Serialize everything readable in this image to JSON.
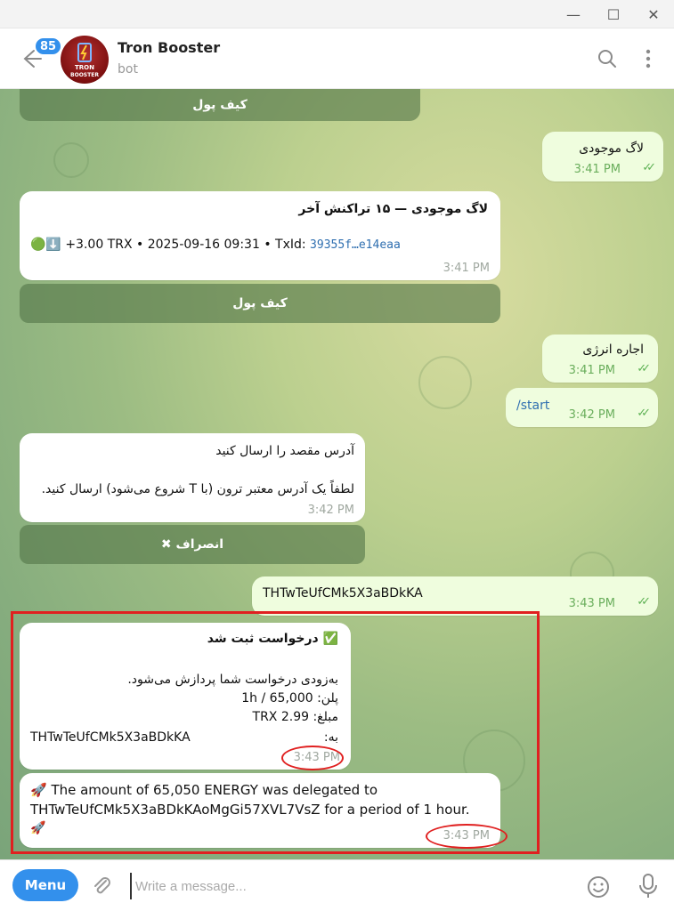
{
  "window": {
    "minimize": "—",
    "maximize": "☐",
    "close": "✕"
  },
  "header": {
    "unread_badge": "85",
    "title": "Tron Booster",
    "subtitle": "bot",
    "avatar_text_line1": "TRON",
    "avatar_text_line2": "BOOSTER"
  },
  "messages": {
    "top_button": "کیف پول",
    "m1_text": "لاگ موجودی",
    "m1_time": "3:41 PM",
    "m2_title": "لاگ موجودی — ۱۵ تراکنش آخر",
    "m2_emoji": "🟢⬇️",
    "m2_amount": " +3.00 TRX • 2025-09-16 09:31 • TxId: ",
    "m2_txid": "39355f…e14eaa",
    "m2_time": "3:41 PM",
    "m2_button": "کیف پول",
    "m3_text": "اجاره انرژی",
    "m3_time": "3:41 PM",
    "m4_text": "/start",
    "m4_time": "3:42 PM",
    "m5_line1": "آدرس مقصد را ارسال کنید",
    "m5_line2": "لطفاً یک آدرس معتبر ترون (با T شروع می‌شود) ارسال کنید.",
    "m5_time": "3:42 PM",
    "m5_button": "✖ انصراف",
    "m6_text": "THTwTeUfCMk5X3aBDkKA",
    "m6_time": "3:43 PM",
    "m7_title": "✅ درخواست ثبت شد",
    "m7_line1": "به‌زودی درخواست شما پردازش می‌شود.",
    "m7_line2": "پلن: 1h / 65,000",
    "m7_line3": "مبلغ: 2.99 TRX",
    "m7_line4_label": "به:",
    "m7_address": "THTwTeUfCMk5X3aBDkKA",
    "m7_time": "3:43 PM",
    "m8_line1": "🚀 The amount of 65,050 ENERGY was delegated to",
    "m8_line2": "THTwTeUfCMk5X3aBDkKAoMgGi57XVL7VsZ for a period of 1 hour.",
    "m8_line3": "🚀",
    "m8_time": "3:43 PM",
    "ticks": "✓✓"
  },
  "composer": {
    "menu_label": "Menu",
    "placeholder": "Write a message..."
  },
  "colors": {
    "accent": "#3390ec",
    "annotation": "#e02020",
    "outgoing_bubble": "#effdde"
  }
}
